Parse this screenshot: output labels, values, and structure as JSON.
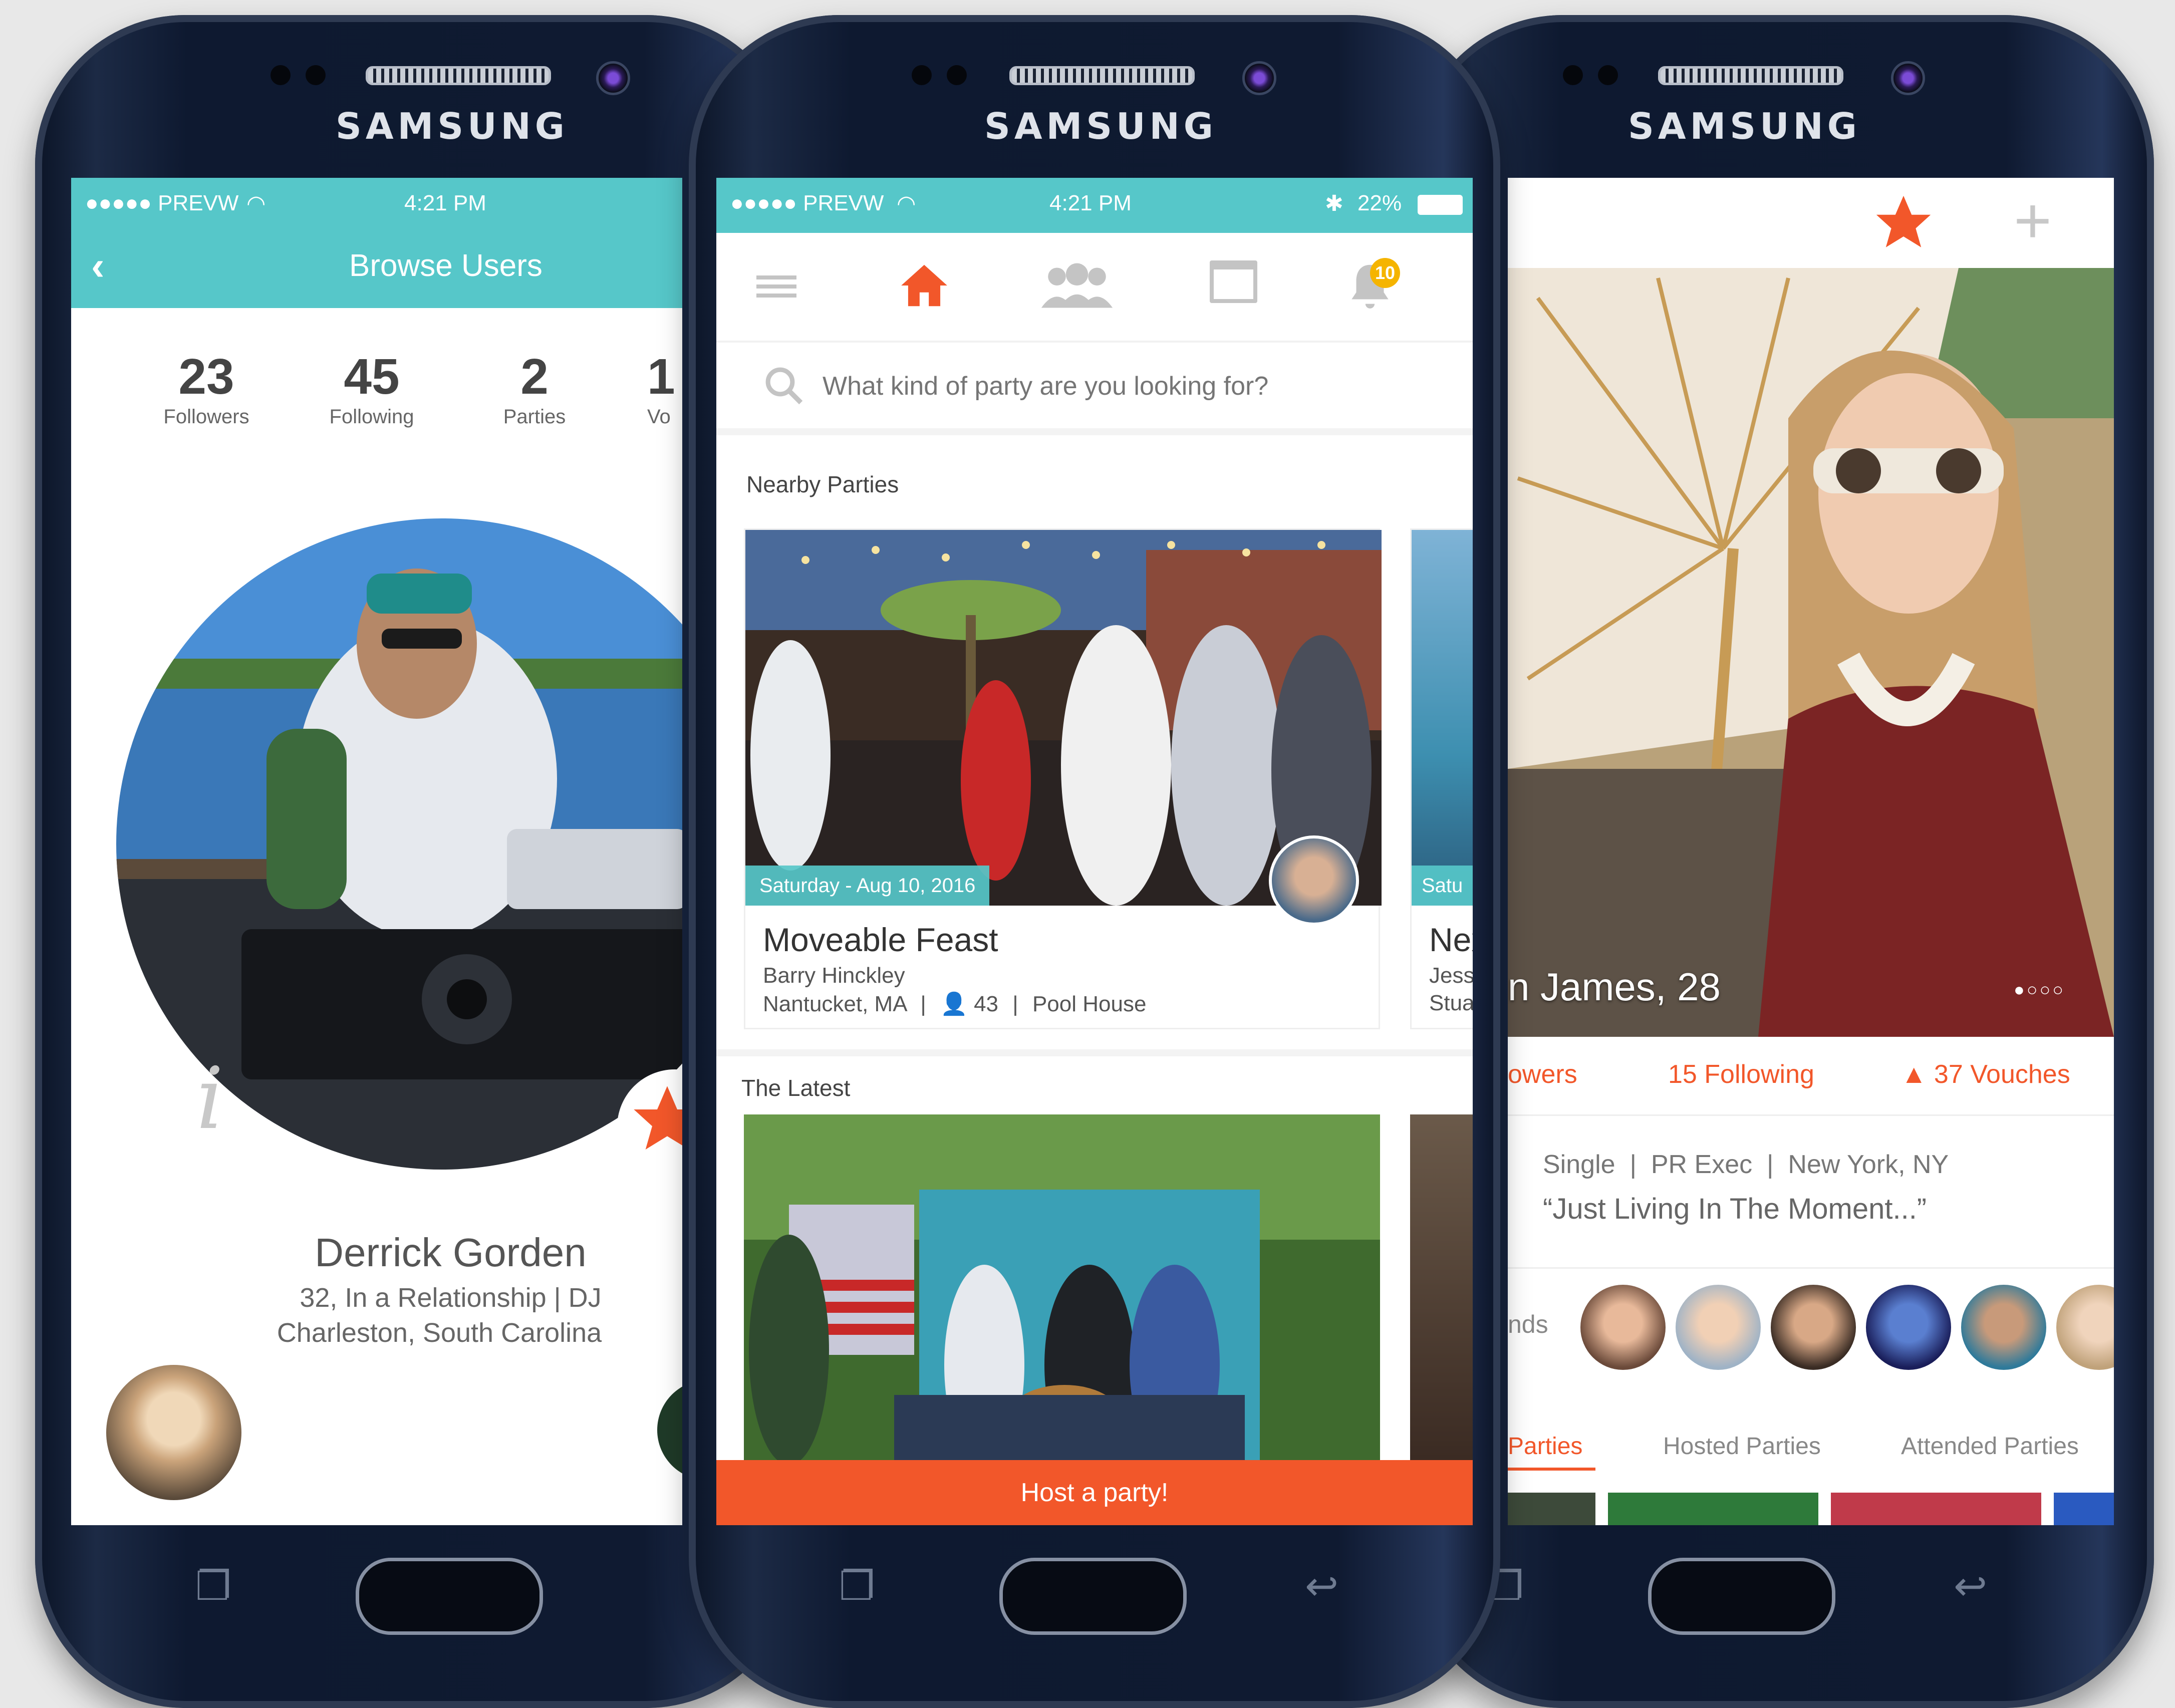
{
  "status_bar": {
    "carrier": "●●●●● PREVW",
    "time": "4:21 PM",
    "battery": "22%"
  },
  "brand": "SAMSUNG",
  "browse": {
    "title": "Browse Users",
    "stats": [
      {
        "value": "23",
        "label": "Followers"
      },
      {
        "value": "45",
        "label": "Following"
      },
      {
        "value": "2",
        "label": "Parties"
      },
      {
        "value": "1",
        "label": "Vo"
      }
    ],
    "user_name": "Derrick Gorden",
    "user_meta": "32, In a Relationship | DJ",
    "user_location": "Charleston, South Carolina"
  },
  "feed": {
    "notification_count": "10",
    "search_placeholder": "What kind of party are you looking for?",
    "nearby_heading": "Nearby Parties",
    "party": {
      "date": "Saturday - Aug 10, 2016",
      "title": "Moveable Feast",
      "host": "Barry Hinckley",
      "location": "Nantucket, MA",
      "attendees": "43",
      "venue": "Pool House"
    },
    "party2": {
      "date": "Satu",
      "title": "Nex",
      "host": "Jessi",
      "location": "Stua"
    },
    "latest_heading": "The Latest",
    "host_button": "Host a party!"
  },
  "profile": {
    "name_age": "n James, 28",
    "followers_partial": "owers",
    "following": "15 Following",
    "vouches": "37 Vouches",
    "details": "Single  |  PR Exec  |  New York, NY",
    "quote": "“Just Living In The Moment...”",
    "friends_partial": "nds",
    "tabs": [
      "Parties",
      "Hosted Parties",
      "Attended Parties"
    ]
  },
  "colors": {
    "teal": "#56c7c9",
    "orange": "#f2572a",
    "accent_star": "#f2572a"
  }
}
